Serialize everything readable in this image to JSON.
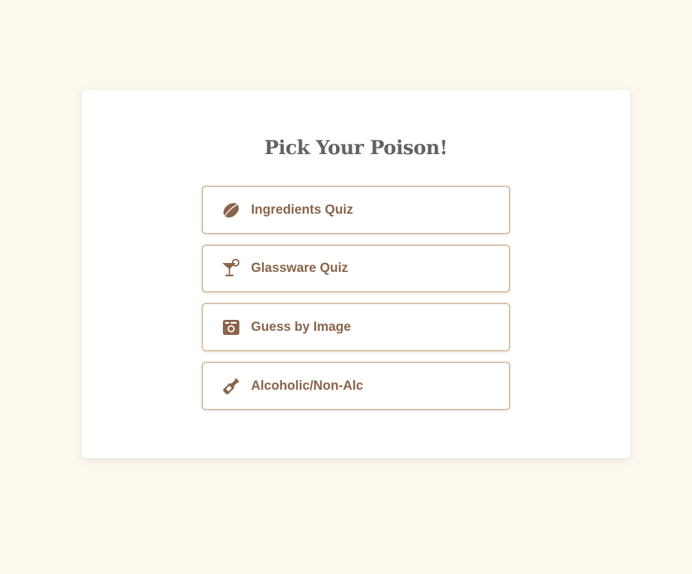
{
  "page": {
    "background": "#fef9ee",
    "accent": "#8a6449",
    "border_color": "#d6bfa4",
    "title_color": "#636363"
  },
  "card": {
    "title": "Pick Your Poison!"
  },
  "menu": {
    "items": [
      {
        "label": "Ingredients Quiz",
        "icon": "lemon-icon"
      },
      {
        "label": "Glassware Quiz",
        "icon": "martini-glass-icon"
      },
      {
        "label": "Guess by Image",
        "icon": "camera-icon"
      },
      {
        "label": "Alcoholic/Non-Alc",
        "icon": "wine-bottle-icon"
      }
    ]
  }
}
